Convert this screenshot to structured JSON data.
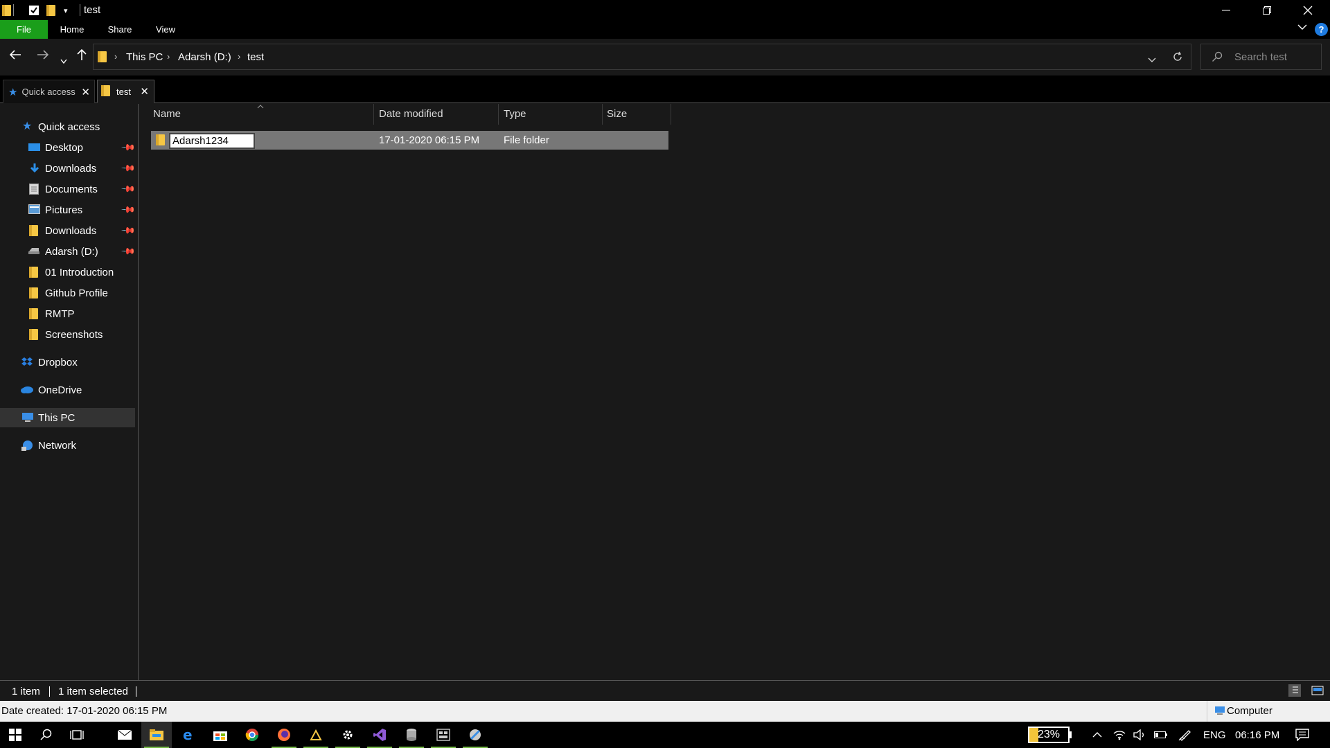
{
  "window": {
    "title": "test"
  },
  "ribbon": {
    "tabs": [
      "File",
      "Home",
      "Share",
      "View"
    ]
  },
  "address": {
    "crumbs": [
      "This PC",
      "Adarsh (D:)",
      "test"
    ]
  },
  "search": {
    "placeholder": "Search test"
  },
  "pane_tabs": [
    {
      "label": "Quick access"
    },
    {
      "label": "test"
    }
  ],
  "sidebar": {
    "items": [
      {
        "label": "Quick access",
        "icon": "star-icon"
      },
      {
        "label": "Desktop",
        "icon": "desktop-icon",
        "pinned": true
      },
      {
        "label": "Downloads",
        "icon": "download-icon",
        "pinned": true
      },
      {
        "label": "Documents",
        "icon": "document-icon",
        "pinned": true
      },
      {
        "label": "Pictures",
        "icon": "pictures-icon",
        "pinned": true
      },
      {
        "label": "Downloads",
        "icon": "folder-icon",
        "pinned": true
      },
      {
        "label": "Adarsh (D:)",
        "icon": "drive-icon",
        "pinned": true
      },
      {
        "label": "01 Introduction",
        "icon": "folder-icon"
      },
      {
        "label": "Github Profile",
        "icon": "folder-icon"
      },
      {
        "label": "RMTP",
        "icon": "folder-icon"
      },
      {
        "label": "Screenshots",
        "icon": "folder-icon"
      },
      {
        "label": "Dropbox",
        "icon": "dropbox-icon"
      },
      {
        "label": "OneDrive",
        "icon": "cloud-icon"
      },
      {
        "label": "This PC",
        "icon": "computer-icon"
      },
      {
        "label": "Network",
        "icon": "network-icon"
      }
    ]
  },
  "columns": {
    "name": "Name",
    "date": "Date modified",
    "type": "Type",
    "size": "Size"
  },
  "files": [
    {
      "name": "Adarsh1234",
      "date": "17-01-2020 06:15 PM",
      "type": "File folder",
      "size": ""
    }
  ],
  "status": {
    "count": "1 item",
    "selected": "1 item selected",
    "details": "Date created: 17-01-2020 06:15 PM",
    "location": "Computer"
  },
  "taskbar": {
    "battery_label": "23%",
    "battery_level": 0.23,
    "lang": "ENG",
    "time": "06:16 PM"
  },
  "colors": {
    "file_tab": "#1a9e1a",
    "folder": "#f6c744",
    "accent": "#1e7be0"
  }
}
